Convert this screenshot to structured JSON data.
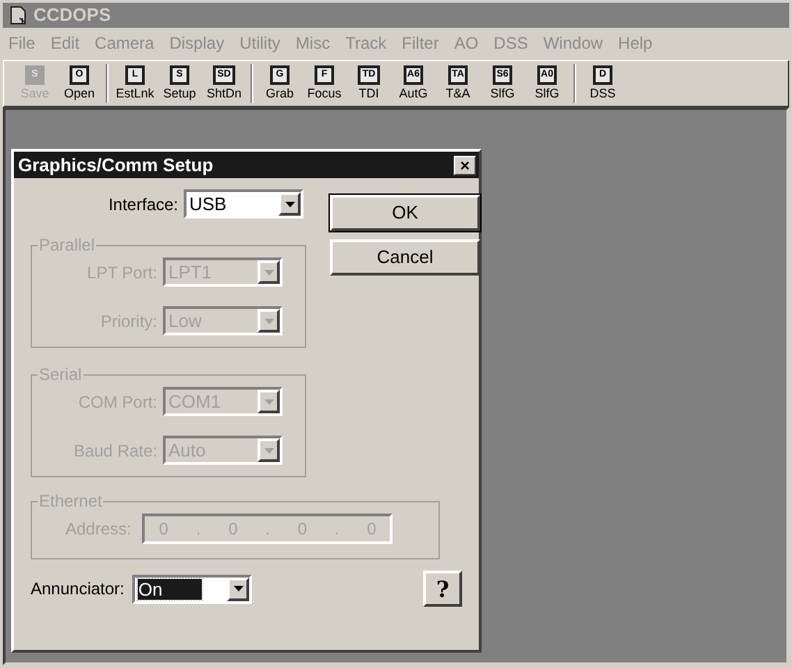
{
  "window": {
    "title": "CCDOPS"
  },
  "menu": [
    "File",
    "Edit",
    "Camera",
    "Display",
    "Utility",
    "Misc",
    "Track",
    "Filter",
    "AO",
    "DSS",
    "Window",
    "Help"
  ],
  "toolbar": [
    [
      {
        "glyph": "S",
        "label": "Save",
        "disabled": true
      },
      {
        "glyph": "O",
        "label": "Open",
        "disabled": false
      }
    ],
    [
      {
        "glyph": "L",
        "label": "EstLnk",
        "disabled": false
      },
      {
        "glyph": "S",
        "label": "Setup",
        "disabled": false
      },
      {
        "glyph": "SD",
        "label": "ShtDn",
        "disabled": false
      }
    ],
    [
      {
        "glyph": "G",
        "label": "Grab",
        "disabled": false
      },
      {
        "glyph": "F",
        "label": "Focus",
        "disabled": false
      },
      {
        "glyph": "TD",
        "label": "TDI",
        "disabled": false
      },
      {
        "glyph": "A6",
        "label": "AutG",
        "disabled": false
      },
      {
        "glyph": "TA",
        "label": "T&A",
        "disabled": false
      },
      {
        "glyph": "S6",
        "label": "SlfG",
        "disabled": false
      },
      {
        "glyph": "A0",
        "label": "SlfG",
        "disabled": false
      }
    ],
    [
      {
        "glyph": "D",
        "label": "DSS",
        "disabled": false
      }
    ]
  ],
  "dialog": {
    "title": "Graphics/Comm Setup",
    "close": "×",
    "interface": {
      "label": "Interface:",
      "value": "USB",
      "disabled": false
    },
    "buttons": [
      "OK",
      "Cancel"
    ],
    "groups": [
      {
        "title": "Parallel",
        "fields": [
          {
            "label": "LPT Port:",
            "value": "LPT1",
            "disabled": true
          },
          {
            "label": "Priority:",
            "value": "Low",
            "disabled": true
          }
        ]
      },
      {
        "title": "Serial",
        "fields": [
          {
            "label": "COM Port:",
            "value": "COM1",
            "disabled": true
          },
          {
            "label": "Baud Rate:",
            "value": "Auto",
            "disabled": true
          }
        ]
      }
    ],
    "ethernet": {
      "title": "Ethernet",
      "label": "Address:",
      "octets": [
        "0",
        "0",
        "0",
        "0"
      ],
      "separator": ".",
      "disabled": true
    },
    "annunciator": {
      "label": "Annunciator:",
      "value": "On",
      "focused": true
    },
    "help": "?"
  }
}
